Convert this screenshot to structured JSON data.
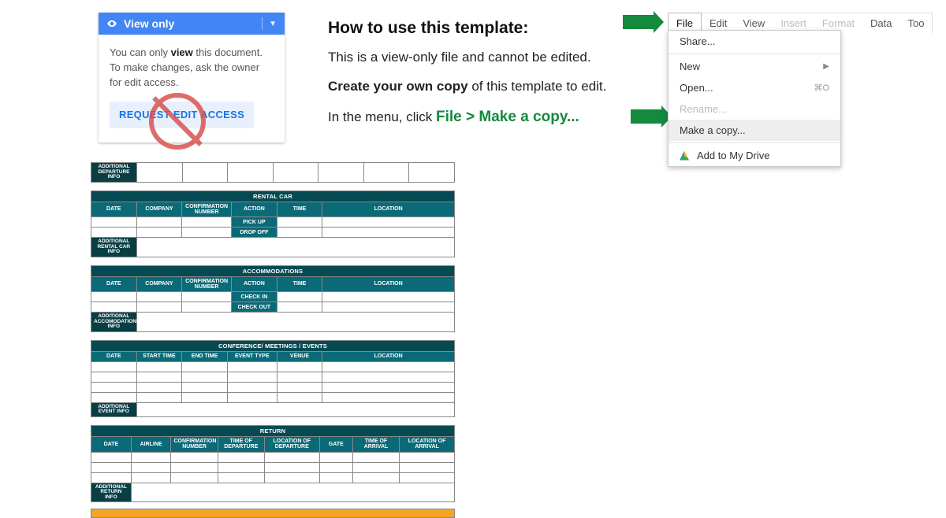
{
  "view_only_card": {
    "badge": "View only",
    "line1a": "You can only ",
    "line1b": "view",
    "line1c": " this document.",
    "line2": "To make changes, ask the owner for edit access.",
    "button": "REQUEST EDIT ACCESS"
  },
  "instructions": {
    "title": "How to use this template:",
    "p1": "This is a view-only file and cannot be edited.",
    "p2a": "Create your own copy",
    "p2b": " of this template to edit.",
    "p3a": "In the menu, click ",
    "p3b": "File > Make a copy..."
  },
  "menubar": {
    "file": "File",
    "edit": "Edit",
    "view": "View",
    "insert": "Insert",
    "format": "Format",
    "data": "Data",
    "tools": "Too"
  },
  "dropdown": {
    "share": "Share...",
    "new": "New",
    "open": "Open...",
    "open_sc": "⌘O",
    "rename": "Rename...",
    "make_copy": "Make a copy...",
    "add_drive": "Add to My Drive"
  },
  "sheet": {
    "dep_info": "ADDITIONAL DEPARTURE INFO",
    "rental": {
      "title": "RENTAL CAR",
      "cols": [
        "DATE",
        "COMPANY",
        "CONFIRMATION NUMBER",
        "ACTION",
        "TIME",
        "LOCATION"
      ],
      "actions": [
        "PICK UP",
        "DROP OFF"
      ],
      "info": "ADDITIONAL RENTAL CAR INFO"
    },
    "acc": {
      "title": "ACCOMMODATIONS",
      "cols": [
        "DATE",
        "COMPANY",
        "CONFIRMATION NUMBER",
        "ACTION",
        "TIME",
        "LOCATION"
      ],
      "actions": [
        "CHECK IN",
        "CHECK OUT"
      ],
      "info": "ADDITIONAL ACCOMODATIONS INFO"
    },
    "conf": {
      "title": "CONFERENCE/ MEETINGS / EVENTS",
      "cols": [
        "DATE",
        "START TIME",
        "END TIME",
        "EVENT TYPE",
        "VENUE",
        "LOCATION"
      ],
      "info": "ADDITIONAL EVENT INFO"
    },
    "ret": {
      "title": "RETURN",
      "cols": [
        "DATE",
        "AIRLINE",
        "CONFIRMATION NUMBER",
        "TIME OF DEPARTURE",
        "LOCATION OF DEPARTURE",
        "GATE",
        "TIME OF ARRIVAL",
        "LOCATION OF ARRIVAL"
      ],
      "info": "ADDITIONAL RETURN INFO"
    }
  }
}
